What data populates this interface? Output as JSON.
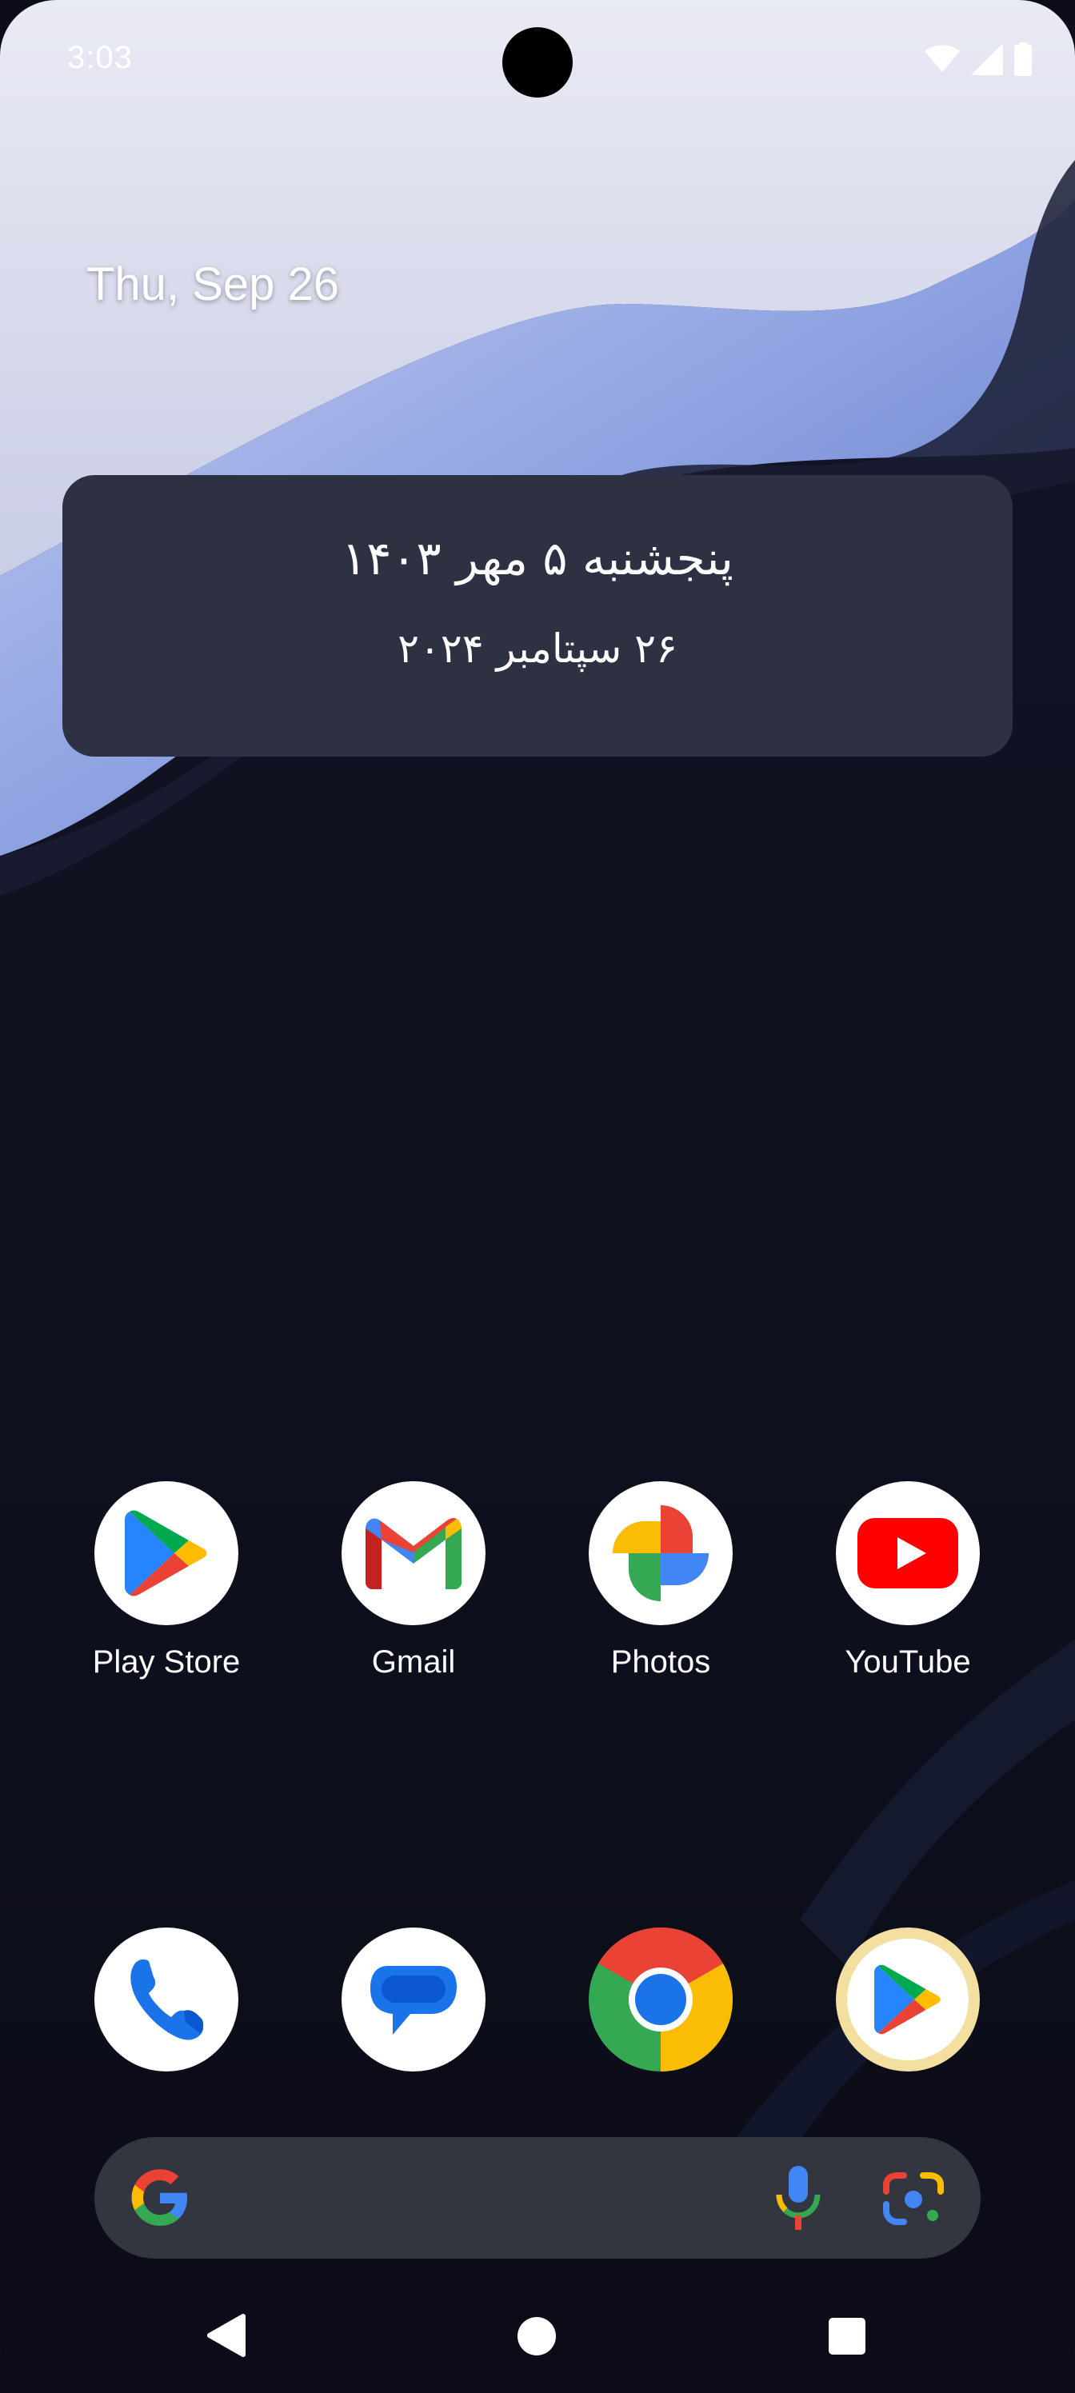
{
  "status_bar": {
    "time": "3:03"
  },
  "home": {
    "date": "Thu, Sep 26"
  },
  "calendar_widget": {
    "persian_date": "پنجشنبه  ۵ مهر ۱۴۰۳",
    "gregorian_date_fa": "۲۶ سپتامبر ۲۰۲۴"
  },
  "apps": [
    {
      "label": "Play Store",
      "icon": "play-store-icon"
    },
    {
      "label": "Gmail",
      "icon": "gmail-icon"
    },
    {
      "label": "Photos",
      "icon": "photos-icon"
    },
    {
      "label": "YouTube",
      "icon": "youtube-icon"
    }
  ],
  "dock": [
    {
      "icon": "phone-icon"
    },
    {
      "icon": "messages-icon"
    },
    {
      "icon": "chrome-icon"
    },
    {
      "icon": "play-store-icon"
    }
  ],
  "search_bar": {
    "icons": [
      "google-g-icon",
      "microphone-icon",
      "lens-icon"
    ]
  },
  "nav_bar": {
    "icons": [
      "back-icon",
      "home-icon",
      "recents-icon"
    ]
  },
  "colors": {
    "widget_bg": "#2e3142",
    "search_bg": "#34363f",
    "wallpaper_dark": "#0d0e1b",
    "wallpaper_light": "#9eb0ea"
  }
}
